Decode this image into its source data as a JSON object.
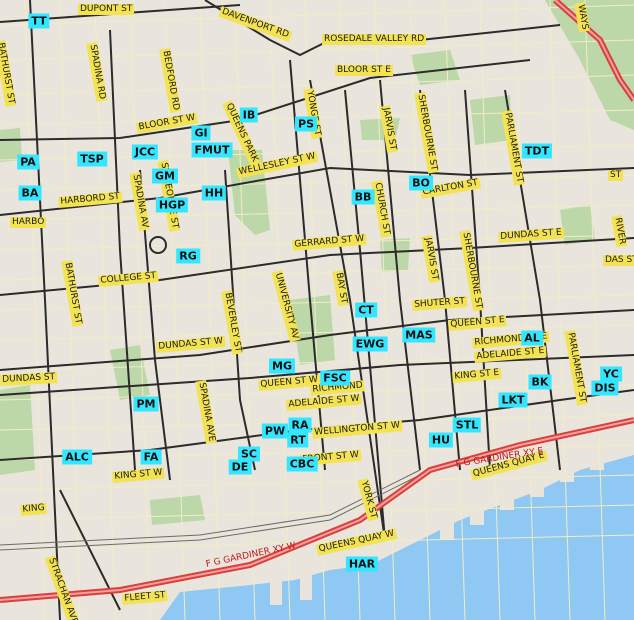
{
  "colors": {
    "land": "#e9e5dc",
    "water": "#8fc8f2",
    "park": "#bcd7a8",
    "major_road": "#2b2b2b",
    "minor_road": "#f2ecc6",
    "highway": "#d9403c",
    "marker": "#33e6ff",
    "street_label_bg": "#f3e352"
  },
  "markers": [
    {
      "code": "TT"
    },
    {
      "code": "IB"
    },
    {
      "code": "PS"
    },
    {
      "code": "GI"
    },
    {
      "code": "FMUT"
    },
    {
      "code": "TSP"
    },
    {
      "code": "JCC"
    },
    {
      "code": "PA"
    },
    {
      "code": "TDT"
    },
    {
      "code": "GM"
    },
    {
      "code": "HH"
    },
    {
      "code": "BO"
    },
    {
      "code": "BA"
    },
    {
      "code": "HGP"
    },
    {
      "code": "BB"
    },
    {
      "code": "RG"
    },
    {
      "code": "CT"
    },
    {
      "code": "MAS"
    },
    {
      "code": "EWG"
    },
    {
      "code": "AL"
    },
    {
      "code": "MG"
    },
    {
      "code": "FSC"
    },
    {
      "code": "YC"
    },
    {
      "code": "BK"
    },
    {
      "code": "DIS"
    },
    {
      "code": "PM"
    },
    {
      "code": "LKT"
    },
    {
      "code": "STL"
    },
    {
      "code": "PW"
    },
    {
      "code": "RA"
    },
    {
      "code": "HU"
    },
    {
      "code": "RT"
    },
    {
      "code": "ALC"
    },
    {
      "code": "FA"
    },
    {
      "code": "SC"
    },
    {
      "code": "CBC"
    },
    {
      "code": "DE"
    },
    {
      "code": "HAR"
    }
  ],
  "streets": [
    {
      "name": "DUPONT ST"
    },
    {
      "name": "DAVENPORT RD"
    },
    {
      "name": "ROSEDALE VALLEY RD"
    },
    {
      "name": "BLOOR ST E"
    },
    {
      "name": "BLOOR ST W"
    },
    {
      "name": "WELLESLEY ST W"
    },
    {
      "name": "HARBORD ST"
    },
    {
      "name": "CARLTON ST"
    },
    {
      "name": "GERRARD ST W"
    },
    {
      "name": "DUNDAS ST E"
    },
    {
      "name": "COLLEGE ST"
    },
    {
      "name": "SHUTER ST"
    },
    {
      "name": "QUEEN ST E"
    },
    {
      "name": "DUNDAS ST W"
    },
    {
      "name": "RICHMOND ST E"
    },
    {
      "name": "ADELAIDE ST E"
    },
    {
      "name": "QUEEN ST W"
    },
    {
      "name": "RICHMOND"
    },
    {
      "name": "KING ST E"
    },
    {
      "name": "ADELAIDE ST W"
    },
    {
      "name": "WELLINGTON ST W"
    },
    {
      "name": "KING ST W"
    },
    {
      "name": "FRONT ST W"
    },
    {
      "name": "QUEENS QUAY E"
    },
    {
      "name": "QUEENS QUAY W"
    },
    {
      "name": "FLEET ST"
    },
    {
      "name": "KING"
    },
    {
      "name": "BATHURST ST"
    },
    {
      "name": "SPADINA RD"
    },
    {
      "name": "BEDFORD RD"
    },
    {
      "name": "QUEENS PARK"
    },
    {
      "name": "YONGE ST"
    },
    {
      "name": "SHERBOURNE ST"
    },
    {
      "name": "JARVIS ST"
    },
    {
      "name": "PARLIAMENT ST"
    },
    {
      "name": "ST GEORGE ST"
    },
    {
      "name": "SPADINA AV"
    },
    {
      "name": "CHURCH ST"
    },
    {
      "name": "UNIVERSITY AV"
    },
    {
      "name": "BEVERLEY ST"
    },
    {
      "name": "BAY ST"
    },
    {
      "name": "SPADINA AVE"
    },
    {
      "name": "YORK ST"
    },
    {
      "name": "STRACHAN AVE"
    },
    {
      "name": "RIVER"
    },
    {
      "name": "DUNDAS ST"
    },
    {
      "name": "HARBO"
    },
    {
      "name": "DAS ST"
    },
    {
      "name": "ST"
    },
    {
      "name": "WAYS"
    }
  ],
  "highways": [
    {
      "name": "F G GARDINER XY E"
    },
    {
      "name": "F G GARDINER XY W"
    }
  ]
}
